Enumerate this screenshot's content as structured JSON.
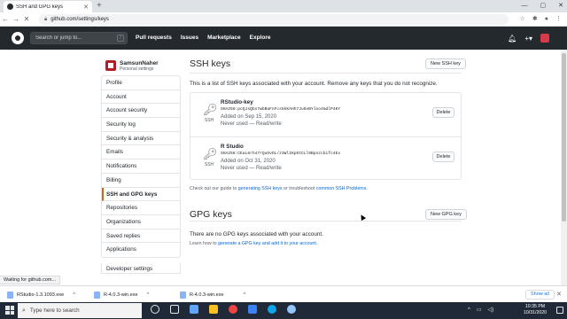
{
  "browser": {
    "tab_title": "SSH and GPG keys",
    "url": "github.com/settings/keys",
    "new_tab": "+",
    "window_controls": [
      "—",
      "▢",
      "✕"
    ]
  },
  "github_header": {
    "search_placeholder": "Search or jump to...",
    "search_shortcut": "/",
    "nav": [
      "Pull requests",
      "Issues",
      "Marketplace",
      "Explore"
    ]
  },
  "profile": {
    "username": "SamsunNaher",
    "subtitle": "Personal settings"
  },
  "sidebar": {
    "items": [
      {
        "label": "Profile"
      },
      {
        "label": "Account"
      },
      {
        "label": "Account security"
      },
      {
        "label": "Security log"
      },
      {
        "label": "Security & analysis"
      },
      {
        "label": "Emails"
      },
      {
        "label": "Notifications"
      },
      {
        "label": "Billing"
      },
      {
        "label": "SSH and GPG keys",
        "active": true
      },
      {
        "label": "Repositories"
      },
      {
        "label": "Organizations"
      },
      {
        "label": "Saved replies"
      },
      {
        "label": "Applications"
      }
    ],
    "developer_settings": "Developer settings"
  },
  "ssh": {
    "title": "SSH keys",
    "new_button": "New SSH key",
    "description": "This is a list of SSH keys associated with your account. Remove any keys that you do not recognize.",
    "keys": [
      {
        "name": "RStudio-key",
        "fingerprint": "SHA256:pcQJsQbx7wbBaFnFcs5kKAHh7Ju9vBYloo4mdlP4KY",
        "added": "Added on Sep 15, 2020",
        "usage": "Never used — Read/write",
        "type": "SSH",
        "delete_label": "Delete"
      },
      {
        "name": "R Studio",
        "fingerprint": "SHA256:CEaL6rh47rQuOvOL/z3WlIKp6tCLl9Bpnzcbifc4Es",
        "added": "Added on Oct 31, 2020",
        "usage": "Never used — Read/write",
        "type": "SSH",
        "delete_label": "Delete"
      }
    ],
    "guide_prefix": "Check out our guide to ",
    "guide_link1": "generating SSH keys",
    "guide_middle": " or troubleshoot ",
    "guide_link2": "common SSH Problems",
    "guide_suffix": "."
  },
  "gpg": {
    "title": "GPG keys",
    "new_button": "New GPG key",
    "empty_text": "There are no GPG keys associated with your account.",
    "learn_prefix": "Learn how to ",
    "learn_link": "generate a GPG key and add it to your account",
    "learn_suffix": "."
  },
  "status_text": "Waiting for github.com...",
  "downloads": {
    "items": [
      "RStudio-1.3.1093.exe",
      "R-4.0.3-win.exe",
      "R-4.0.3-win.exe"
    ],
    "show_all": "Show all"
  },
  "taskbar": {
    "search_placeholder": "Type here to search",
    "time": "10:35 PM",
    "date": "10/31/2020"
  },
  "colors": {
    "github_header": "#24292e",
    "link": "#0366d6",
    "active_marker": "#e36209"
  }
}
